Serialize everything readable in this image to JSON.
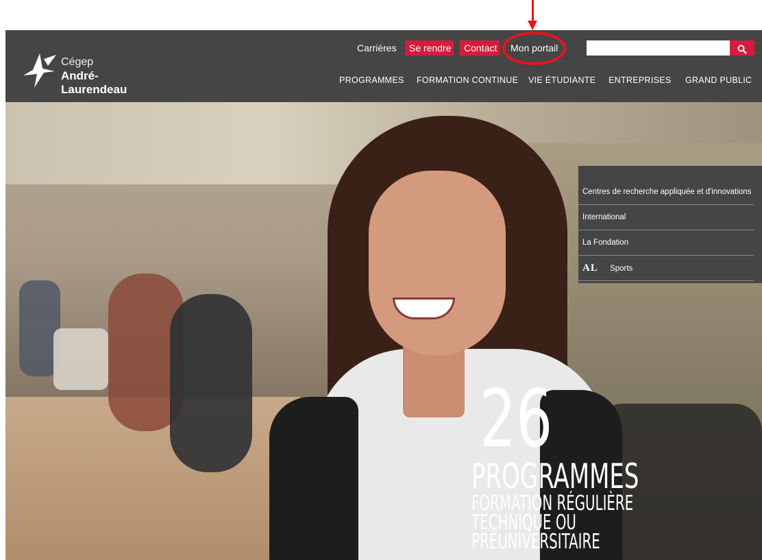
{
  "brand": {
    "line1": "Cégep",
    "line2": "André-Laurendeau"
  },
  "utility_nav": {
    "careers": "Carrières",
    "se_rendre": "Se rendre",
    "contact": "Contact",
    "mon_portail": "Mon portail",
    "search_placeholder": "",
    "search_icon": "search-icon"
  },
  "main_nav": [
    "PROGRAMMES",
    "FORMATION CONTINUE",
    "VIE ÉTUDIANTE",
    "ENTREPRISES",
    "GRAND PUBLIC"
  ],
  "side_menu": {
    "items": [
      "Centres de recherche appliquée et d'innovations",
      "International",
      "La Fondation",
      "Sports"
    ],
    "sports_logo": "AL"
  },
  "hero": {
    "number": "26",
    "headline": "PROGRAMMES",
    "lines": [
      "FORMATION RÉGULIÈRE",
      "TECHNIQUE OU",
      "PRÉUNIVERSITAIRE"
    ]
  },
  "colors": {
    "header_bg": "#454545",
    "accent_red": "#d81b3c",
    "annotation_red": "#e8141b"
  }
}
